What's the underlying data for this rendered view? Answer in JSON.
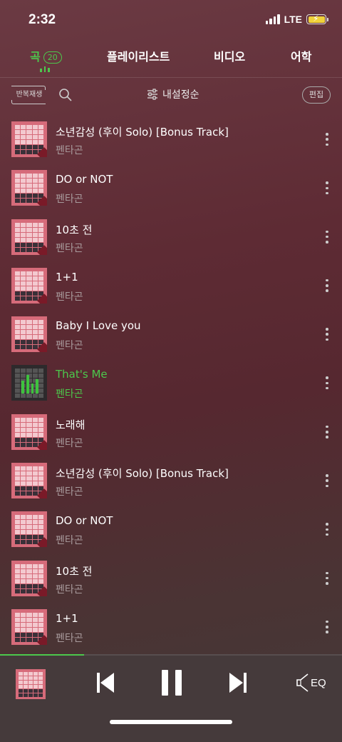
{
  "status": {
    "time": "2:32",
    "network": "LTE",
    "signal_icon": "signal-bars-icon",
    "battery_icon": "battery-charging-icon",
    "battery_color": "#f0d23a"
  },
  "tabs": [
    {
      "label": "곡",
      "count": "20",
      "active": true
    },
    {
      "label": "플레이리스트",
      "active": false
    },
    {
      "label": "비디오",
      "active": false
    },
    {
      "label": "어학",
      "active": false
    }
  ],
  "toolbar": {
    "repeat_label": "반복재생",
    "sort_label": "내설정순",
    "edit_label": "편집"
  },
  "songs": [
    {
      "title": "소년감성 (후이 Solo) [Bonus Track]",
      "artist": "펜타곤"
    },
    {
      "title": "DO or NOT",
      "artist": "펜타곤"
    },
    {
      "title": "10초 전",
      "artist": "펜타곤"
    },
    {
      "title": "1+1",
      "artist": "펜타곤"
    },
    {
      "title": "Baby I Love you",
      "artist": "펜타곤"
    },
    {
      "title": "That's Me",
      "artist": "펜타곤",
      "current": true
    },
    {
      "title": "노래해",
      "artist": "펜타곤"
    },
    {
      "title": "소년감성 (후이 Solo) [Bonus Track]",
      "artist": "펜타곤"
    },
    {
      "title": "DO or NOT",
      "artist": "펜타곤"
    },
    {
      "title": "10초 전",
      "artist": "펜타곤"
    },
    {
      "title": "1+1",
      "artist": "펜타곤"
    }
  ],
  "player": {
    "progress_fraction": 0.245,
    "eq_label": "EQ",
    "accent_color": "#4cc84c"
  }
}
